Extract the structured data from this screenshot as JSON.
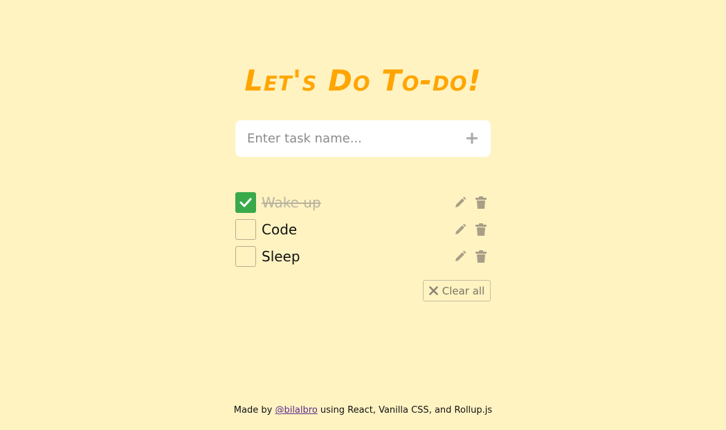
{
  "app": {
    "title": "Let's Do To-do!"
  },
  "new_task": {
    "placeholder": "Enter task name...",
    "value": "",
    "add_icon": "plus-icon"
  },
  "tasks": [
    {
      "label": "Wake up",
      "done": true
    },
    {
      "label": "Code",
      "done": false
    },
    {
      "label": "Sleep",
      "done": false
    }
  ],
  "actions": {
    "edit_icon": "pencil-icon",
    "delete_icon": "trash-icon"
  },
  "clear_all": {
    "label": "Clear all",
    "icon": "close-icon"
  },
  "footer": {
    "prefix": "Made by ",
    "author": "@bilalbro",
    "suffix": " using React, Vanilla CSS, and Rollup.js"
  },
  "colors": {
    "background": "#fff3c2",
    "title": "#ffa500",
    "checked": "#3aa94a",
    "icon": "#a89f86"
  }
}
